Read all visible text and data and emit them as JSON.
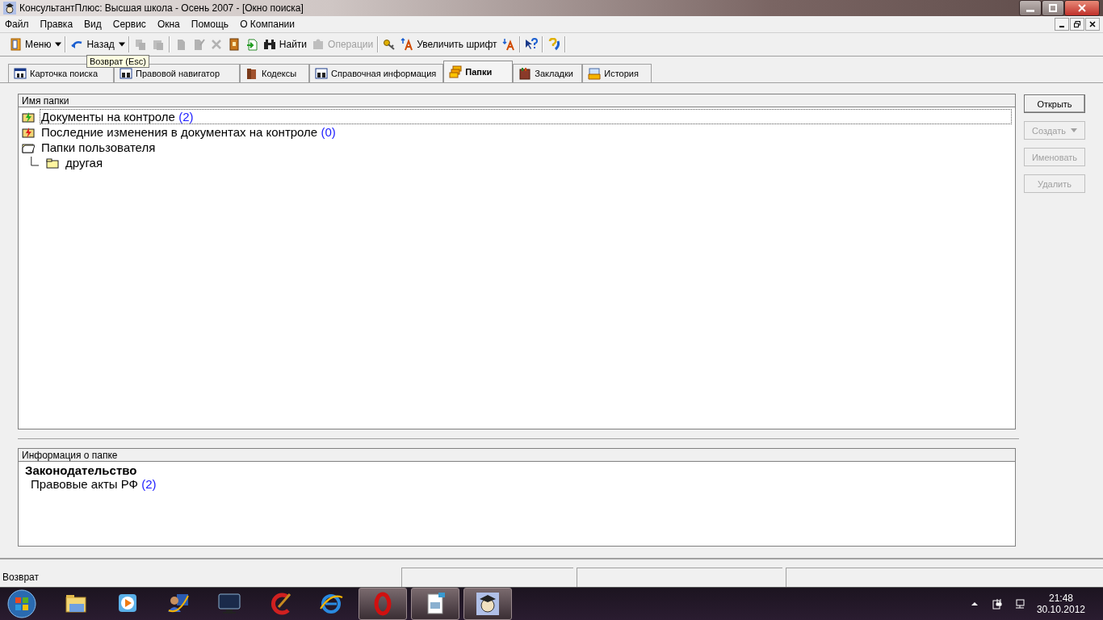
{
  "window": {
    "title": "КонсультантПлюс: Высшая школа - Осень 2007 - [Окно поиска]"
  },
  "menu": [
    "Файл",
    "Правка",
    "Вид",
    "Сервис",
    "Окна",
    "Помощь",
    "О Компании"
  ],
  "toolbar": [
    {
      "kind": "button",
      "label": "Меню",
      "disabled": false
    },
    {
      "kind": "dropdown",
      "disabled": false
    },
    {
      "kind": "separator"
    },
    {
      "kind": "button",
      "label": "Назад",
      "disabled": false
    },
    {
      "kind": "dropdown",
      "disabled": false
    },
    {
      "kind": "separator"
    },
    {
      "kind": "icon",
      "disabled": true
    },
    {
      "kind": "icon",
      "disabled": true
    },
    {
      "kind": "separator"
    },
    {
      "kind": "icon",
      "disabled": true
    },
    {
      "kind": "icon",
      "disabled": true
    },
    {
      "kind": "icon",
      "disabled": true
    },
    {
      "kind": "icon",
      "disabled": false
    },
    {
      "kind": "icon",
      "disabled": false
    },
    {
      "kind": "button",
      "label": "Найти",
      "disabled": false
    },
    {
      "kind": "button",
      "label": "Операции",
      "disabled": true
    },
    {
      "kind": "separator"
    },
    {
      "kind": "icon",
      "disabled": false
    },
    {
      "kind": "button",
      "label": "Увеличить шрифт",
      "disabled": false
    },
    {
      "kind": "icon",
      "disabled": false
    },
    {
      "kind": "separator"
    },
    {
      "kind": "icon",
      "disabled": false
    },
    {
      "kind": "separator"
    },
    {
      "kind": "icon",
      "disabled": false
    },
    {
      "kind": "separator"
    }
  ],
  "tooltip": "Возврат (Esc)",
  "tabs": [
    {
      "label": "Карточка поиска",
      "selected": false
    },
    {
      "label": "Правовой навигатор",
      "selected": false
    },
    {
      "label": "Кодексы",
      "selected": false
    },
    {
      "label": "Справочная информация",
      "selected": false
    },
    {
      "label": "Папки",
      "selected": true
    },
    {
      "label": "Закладки",
      "selected": false
    },
    {
      "label": "История",
      "selected": false
    }
  ],
  "folders": {
    "header": "Имя папки",
    "items": [
      {
        "label": "Документы на контроле",
        "count": "(2)",
        "selected": true
      },
      {
        "label": "Последние изменения в документах на контроле",
        "count": "(0)",
        "selected": false
      },
      {
        "label": "Папки пользователя",
        "selected": false,
        "children": [
          {
            "label": "другая",
            "selected": false
          }
        ]
      }
    ]
  },
  "buttons": [
    {
      "label": "Открыть",
      "disabled": false,
      "dropdown": false
    },
    {
      "label": "Создать",
      "disabled": true,
      "dropdown": true
    },
    {
      "label": "Именовать",
      "disabled": true,
      "dropdown": false
    },
    {
      "label": "Удалить",
      "disabled": true,
      "dropdown": false
    }
  ],
  "info": {
    "header": "Информация о папке",
    "title": "Законодательство",
    "lines": [
      {
        "label": "Правовые акты РФ",
        "count": "(2)"
      }
    ]
  },
  "status_bar": {
    "text": "Возврат"
  },
  "taskbar": {
    "items": [
      {
        "running": false
      },
      {
        "running": false
      },
      {
        "running": false
      },
      {
        "running": false
      },
      {
        "running": false
      },
      {
        "running": false
      },
      {
        "running": true
      },
      {
        "running": true
      },
      {
        "running": true
      }
    ],
    "clock": {
      "time": "21:48",
      "date": "30.10.2012"
    }
  }
}
